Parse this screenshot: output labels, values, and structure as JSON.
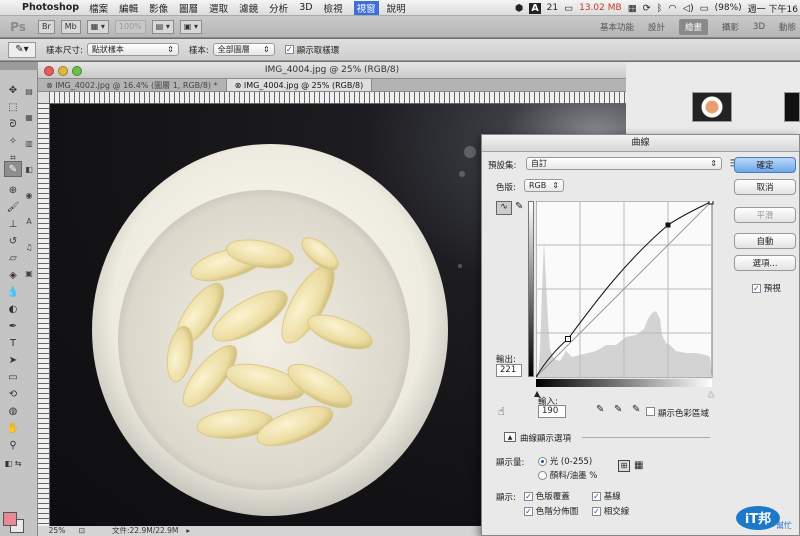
{
  "menubar": {
    "app_name": "Photoshop",
    "items": [
      "檔案",
      "編輯",
      "影像",
      "圖層",
      "選取",
      "濾鏡",
      "分析",
      "3D",
      "檢視",
      "視窗",
      "說明"
    ],
    "active_item": "視窗",
    "status": {
      "notifications": "21",
      "memory": "13.02 MB",
      "battery": "(98%)",
      "clock": "週一 下午16"
    }
  },
  "appbar": {
    "logo": "Ps",
    "zoom_select": "100%",
    "workspace_tabs": [
      "基本功能",
      "設計",
      "繪畫",
      "攝影",
      "3D",
      "動態"
    ],
    "active_workspace": "繪畫"
  },
  "options": {
    "sample_size_label": "樣本尺寸:",
    "sample_size_value": "點狀樣本",
    "sample_label": "樣本:",
    "sample_value": "全部圖層",
    "show_ring_label": "顯示取樣環"
  },
  "document": {
    "window_title": "IMG_4004.jpg @ 25% (RGB/8)",
    "tabs": [
      {
        "label": "IMG_4002.jpg @ 16.4% (圖層 1, RGB/8) *",
        "active": false
      },
      {
        "label": "IMG_4004.jpg @ 25% (RGB/8)",
        "active": true
      }
    ],
    "status_zoom": "25%",
    "status_file": "文件:22.9M/22.9M"
  },
  "curves": {
    "title": "曲線",
    "preset_label": "預設集:",
    "preset_value": "自訂",
    "channel_label": "色版:",
    "channel_value": "RGB",
    "output_label": "輸出:",
    "output_value": "221",
    "input_label": "輸入:",
    "input_value": "190",
    "show_clipping_label": "顯示色彩區域",
    "display_options_label": "曲線顯示選項",
    "show_amount_label": "顯示量:",
    "light_option": "光 (0-255)",
    "pigment_option": "顏料/油墨 %",
    "show_label": "顯示:",
    "channel_overlays": "色版覆蓋",
    "baseline": "基線",
    "histogram": "色階分佈圖",
    "intersection_line": "相交線",
    "buttons": {
      "ok": "確定",
      "cancel": "取消",
      "smooth": "平滑",
      "auto": "自動",
      "options": "選項...",
      "preview": "預視"
    }
  },
  "watermark": {
    "text": "iT邦",
    "sub": "幫忙"
  },
  "colors": {
    "accent": "#3d6fd8",
    "foreground_swatch": "#e88a96",
    "primary_button": "#6da6e9"
  }
}
